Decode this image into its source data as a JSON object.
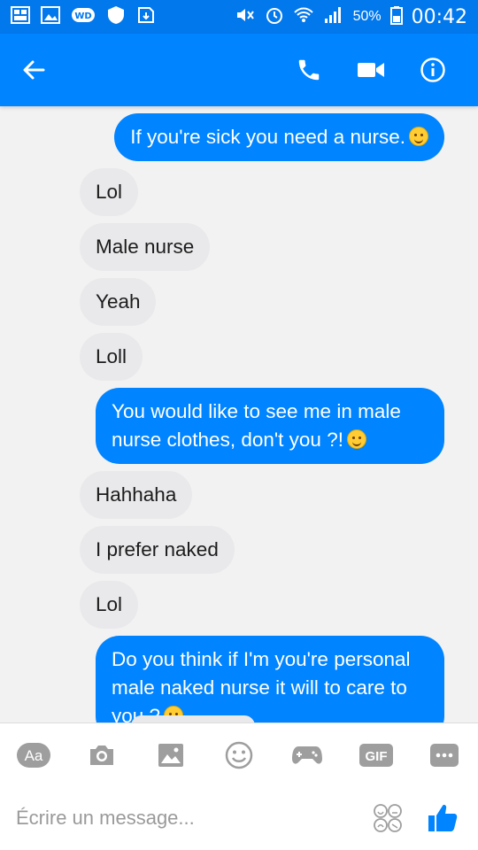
{
  "status_bar": {
    "battery_pct": "50%",
    "time": "00:42"
  },
  "header": {
    "back_icon": "arrow-left-icon",
    "actions": [
      "phone-icon",
      "video-icon",
      "info-icon"
    ]
  },
  "messages": [
    {
      "dir": "out",
      "text": "If you're sick you need a nurse.",
      "emoji": true
    },
    {
      "dir": "in",
      "text": "Lol"
    },
    {
      "dir": "in",
      "text": "Male nurse"
    },
    {
      "dir": "in",
      "text": "Yeah"
    },
    {
      "dir": "in",
      "text": "Loll"
    },
    {
      "dir": "out",
      "text": "You would like to see me in male nurse clothes, don't you ?!",
      "emoji": true
    },
    {
      "dir": "in",
      "text": "Hahhaha"
    },
    {
      "dir": "in",
      "text": "I prefer naked"
    },
    {
      "dir": "in",
      "text": "Lol"
    },
    {
      "dir": "out",
      "text": "Do you think if I'm you're personal male naked nurse it will to care to you ?",
      "emoji": true
    }
  ],
  "composer": {
    "tools": {
      "aa_label": "Aa",
      "gif_label": "GIF"
    },
    "placeholder": "Écrire un message...",
    "colors": {
      "accent": "#0084ff",
      "icon": "#9e9e9e"
    }
  }
}
